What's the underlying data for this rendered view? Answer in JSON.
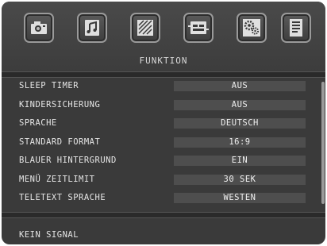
{
  "header": {
    "title": "FUNKTION",
    "icons": [
      {
        "name": "camera-icon"
      },
      {
        "name": "music-note-icon"
      },
      {
        "name": "picture-adjust-icon"
      },
      {
        "name": "connector-icon"
      },
      {
        "name": "settings-gears-icon"
      },
      {
        "name": "document-icon"
      }
    ]
  },
  "menu": {
    "items": [
      {
        "label": "SLEEP TIMER",
        "value": "AUS"
      },
      {
        "label": "KINDERSICHERUNG",
        "value": "AUS"
      },
      {
        "label": "SPRACHE",
        "value": "DEUTSCH"
      },
      {
        "label": "STANDARD FORMAT",
        "value": "16:9"
      },
      {
        "label": "BLAUER HINTERGRUND",
        "value": "EIN"
      },
      {
        "label": "MENÜ ZEITLIMIT",
        "value": "30 SEK"
      },
      {
        "label": "TELETEXT SPRACHE",
        "value": "WESTEN"
      }
    ]
  },
  "status": {
    "text": "KEIN SIGNAL"
  },
  "colors": {
    "panel": "#3a3a3a",
    "value_bg": "#4e4e4e",
    "text": "#e6e6e6"
  }
}
